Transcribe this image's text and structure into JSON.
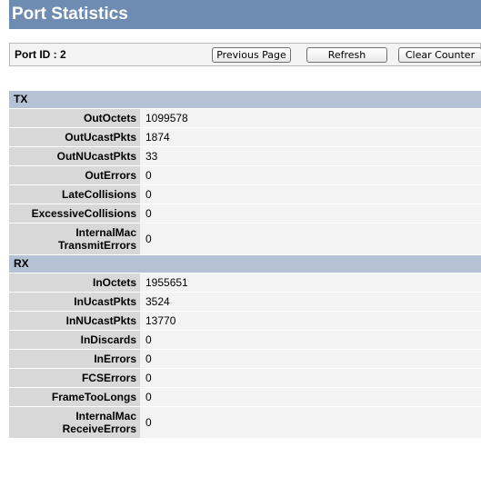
{
  "page": {
    "title": "Port Statistics"
  },
  "port": {
    "id_label": "Port ID : 2"
  },
  "buttons": {
    "previous": "Previous Page",
    "refresh": "Refresh",
    "clear": "Clear Counter"
  },
  "tx": {
    "header": "TX",
    "rows": [
      {
        "label": "OutOctets",
        "value": "1099578"
      },
      {
        "label": "OutUcastPkts",
        "value": "1874"
      },
      {
        "label": "OutNUcastPkts",
        "value": "33"
      },
      {
        "label": "OutErrors",
        "value": "0"
      },
      {
        "label": "LateCollisions",
        "value": "0"
      },
      {
        "label": "ExcessiveCollisions",
        "value": "0"
      },
      {
        "label_line1": "InternalMac",
        "label_line2": "TransmitErrors",
        "value": "0"
      }
    ]
  },
  "rx": {
    "header": "RX",
    "rows": [
      {
        "label": "InOctets",
        "value": "1955651"
      },
      {
        "label": "InUcastPkts",
        "value": "3524"
      },
      {
        "label": "InNUcastPkts",
        "value": "13770"
      },
      {
        "label": "InDiscards",
        "value": "0"
      },
      {
        "label": "InErrors",
        "value": "0"
      },
      {
        "label": "FCSErrors",
        "value": "0"
      },
      {
        "label": "FrameTooLongs",
        "value": "0"
      },
      {
        "label_line1": "InternalMac",
        "label_line2": "ReceiveErrors",
        "value": "0"
      }
    ]
  }
}
